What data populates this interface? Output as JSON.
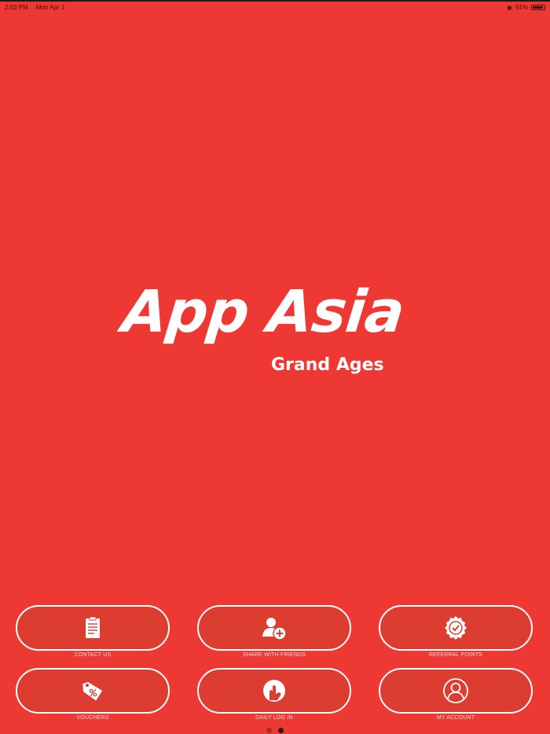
{
  "status_bar": {
    "time": "2:03 PM",
    "date": "Mon Apr 1",
    "battery": "91%"
  },
  "logo": {
    "title": "App Asia",
    "subtitle": "Grand Ages"
  },
  "menu": [
    {
      "label": "CONTACT US",
      "icon": "clipboard-icon"
    },
    {
      "label": "SHARE WITH FRIENDS",
      "icon": "add-user-icon"
    },
    {
      "label": "REFERRAL POINTS",
      "icon": "badge-check-icon"
    },
    {
      "label": "VOUCHERS",
      "icon": "discount-tag-icon"
    },
    {
      "label": "DAILY LOG IN",
      "icon": "touch-login-icon"
    },
    {
      "label": "MY ACCOUNT",
      "icon": "user-account-icon"
    }
  ],
  "colors": {
    "background": "#ee3834",
    "button_fill": "#dc3d30",
    "button_border": "#ffffff"
  },
  "pagination": {
    "pages": 2,
    "current": 2
  }
}
